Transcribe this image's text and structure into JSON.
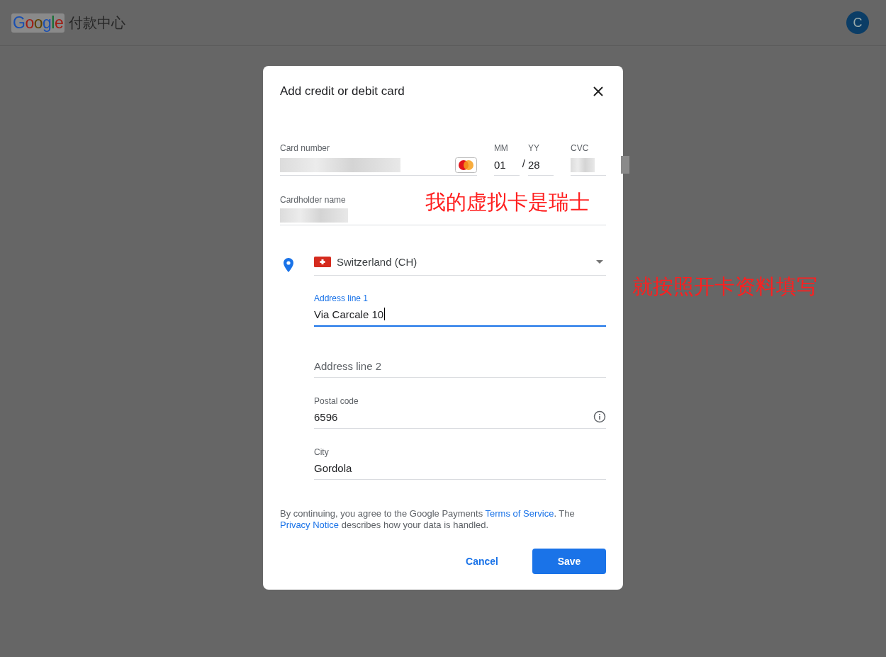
{
  "header": {
    "logo": "Google",
    "title": "付款中心",
    "avatar": "C"
  },
  "dialog": {
    "title": "Add credit or debit card",
    "card": {
      "number_label": "Card number",
      "month_label": "MM",
      "month": "01",
      "year_label": "YY",
      "separator": "/",
      "year": "28",
      "cvc_label": "CVC",
      "holder_label": "Cardholder name"
    },
    "country": "Switzerland (CH)",
    "address_fields": [
      {
        "label": "Address line 1",
        "value": "Via Carcale 10",
        "focused": true,
        "info": false
      },
      {
        "placeholder": "Address line 2",
        "focused": false,
        "info": false
      },
      {
        "label": "Postal code",
        "value": "6596",
        "focused": false,
        "info": true
      },
      {
        "label": "City",
        "value": "Gordola",
        "focused": false,
        "info": false
      }
    ],
    "legal": [
      {
        "kind": "text",
        "text": "By continuing, you agree to the Google Payments "
      },
      {
        "kind": "link",
        "text": "Terms of Service"
      },
      {
        "kind": "text",
        "text": ". The "
      },
      {
        "kind": "link",
        "text": "Privacy Notice"
      },
      {
        "kind": "text",
        "text": " describes how your data is handled."
      }
    ],
    "buttons": {
      "cancel": "Cancel",
      "save": "Save"
    }
  },
  "annotations": [
    "我的虚拟卡是瑞士",
    "就按照开卡资料填写"
  ]
}
